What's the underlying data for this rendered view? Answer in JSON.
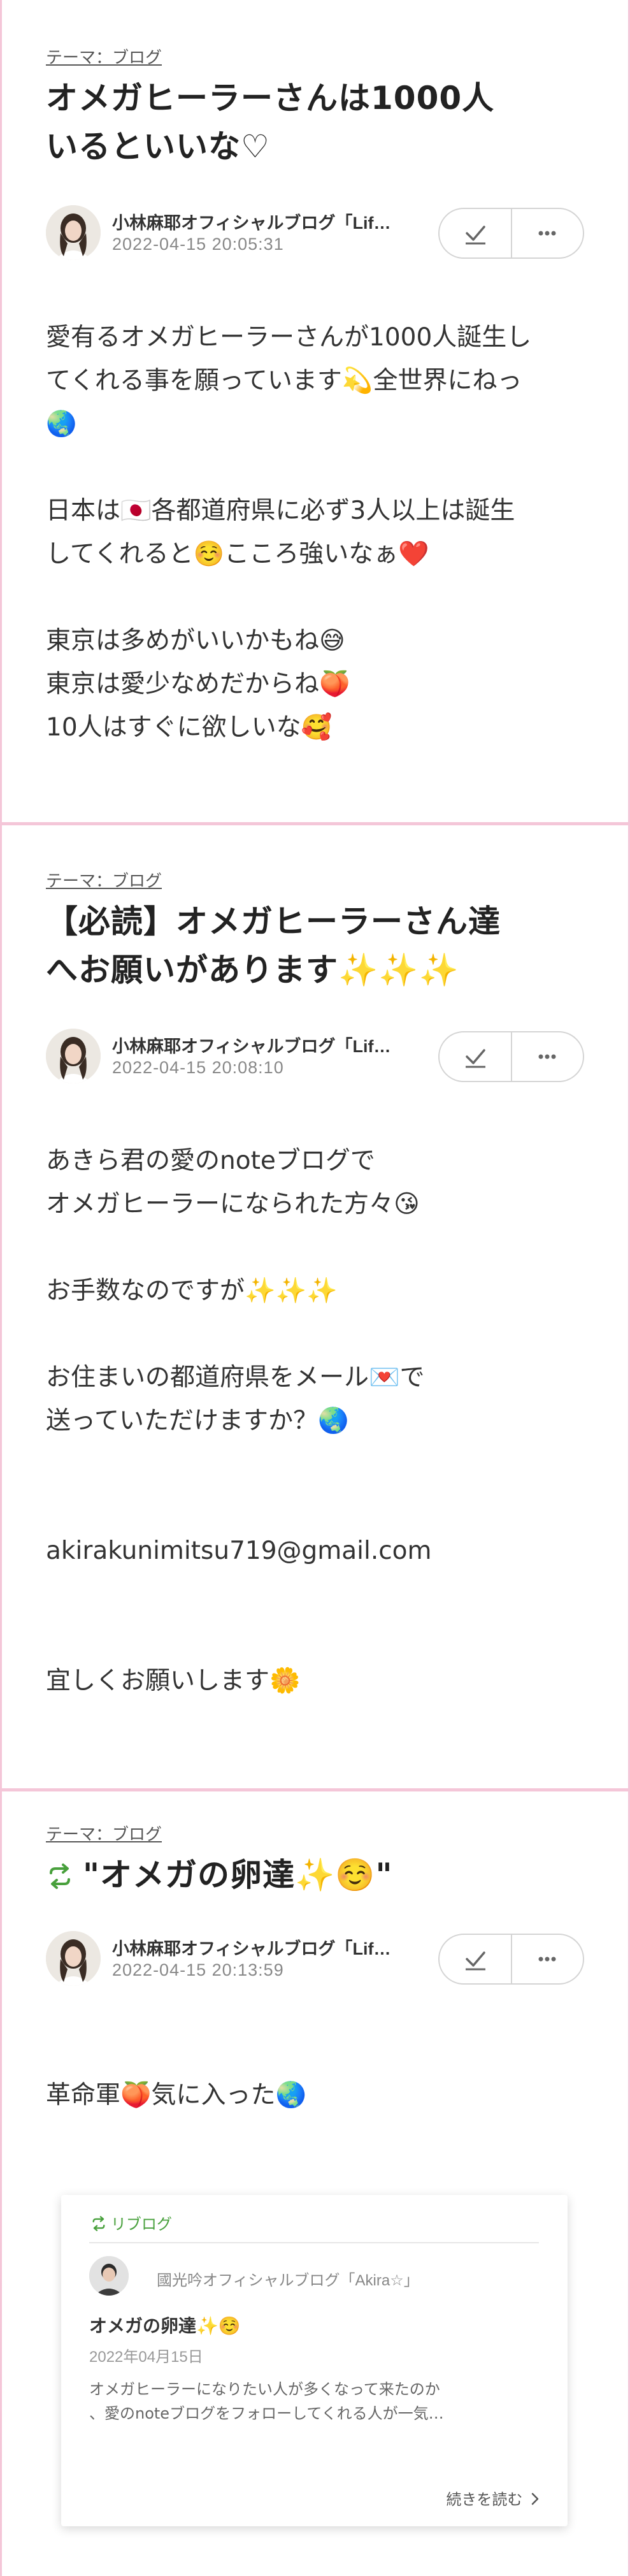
{
  "posts": [
    {
      "theme": "テーマ：ブログ",
      "title_lines": [
        "オメガヒーラーさんは1000人",
        "いるといいな♡"
      ],
      "author": "小林麻耶オフィシャルブログ「Lif…",
      "date": "2022-04-15 20:05:31",
      "body": [
        "愛有るオメガヒーラーさんが1000人誕生し",
        "てくれる事を願っています💫全世界にねっ",
        "🌏",
        "",
        "日本は🇯🇵各都道府県に必ず3人以上は誕生",
        "してくれると☺️こころ強いなぁ❤️",
        "",
        "東京は多めがいいかもね😅",
        "東京は愛少なめだからね🍑",
        "10人はすぐに欲しいな🥰"
      ]
    },
    {
      "theme": "テーマ：ブログ",
      "title_lines": [
        "【必読】オメガヒーラーさん達",
        "へお願いがあります✨✨✨"
      ],
      "author": "小林麻耶オフィシャルブログ「Lif…",
      "date": "2022-04-15 20:08:10",
      "body": [
        "あきら君の愛のnoteブログで",
        "オメガヒーラーになられた方々😘",
        "",
        "お手数なのですが✨✨✨",
        "",
        "お住まいの都道府県をメール💌で",
        "送っていただけますか？🌏",
        "",
        "",
        "akirakunimitsu719@gmail.com",
        "",
        "",
        "宜しくお願いします🌼"
      ]
    },
    {
      "theme": "テーマ：ブログ",
      "title_lines": [
        "\"オメガの卵達✨☺️\""
      ],
      "author": "小林麻耶オフィシャルブログ「Lif…",
      "date": "2022-04-15 20:13:59",
      "body": [
        "革命軍🍑気に入った🌏"
      ]
    }
  ],
  "reblog": {
    "header": "リブログ",
    "blog_name": "國光吟オフィシャルブログ「Akira☆」",
    "title": "オメガの卵達✨☺️",
    "date": "2022年04月15日",
    "excerpt_lines": [
      "オメガヒーラーになりたい人が多くなって来たのか",
      "、愛のnoteブログをフォローしてくれる人が一気…"
    ],
    "read_more": "続きを読む"
  },
  "colors": {
    "frame_pink": "#f4c6d8",
    "reblog_green": "#48a03c",
    "date_gray": "#888888"
  },
  "icons": {
    "check": "check-icon",
    "more": "more-dots-icon",
    "reblog": "reblog-icon",
    "chevron": "chevron-right-icon"
  }
}
